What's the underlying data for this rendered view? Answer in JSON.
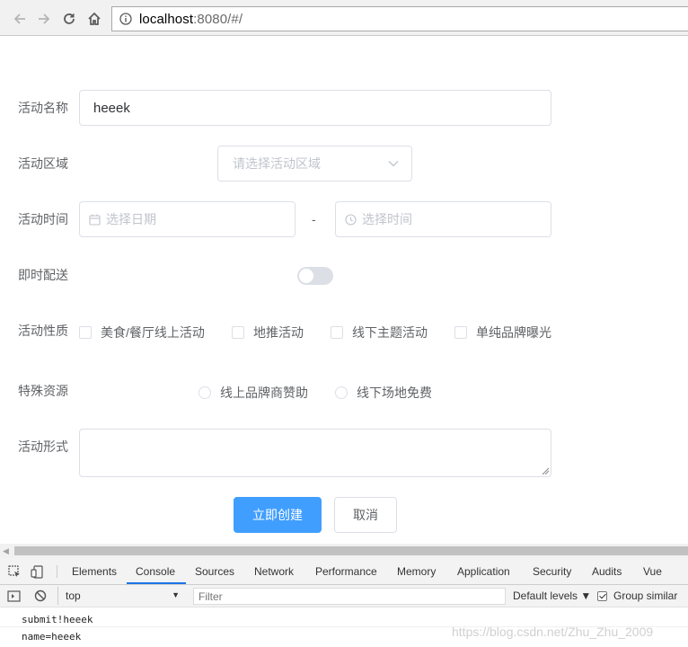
{
  "browser": {
    "url_host": "localhost",
    "url_path": ":8080/#/"
  },
  "form": {
    "name_label": "活动名称",
    "name_value": "heeek",
    "region_label": "活动区域",
    "region_placeholder": "请选择活动区域",
    "time_label": "活动时间",
    "date_placeholder": "选择日期",
    "time_separator": "-",
    "time_placeholder": "选择时间",
    "delivery_label": "即时配送",
    "delivery_on": false,
    "type_label": "活动性质",
    "type_options": [
      "美食/餐厅线上活动",
      "地推活动",
      "线下主题活动",
      "单纯品牌曝光"
    ],
    "resource_label": "特殊资源",
    "resource_options": [
      "线上品牌商赞助",
      "线下场地免费"
    ],
    "form_label": "活动形式",
    "submit_label": "立即创建",
    "cancel_label": "取消"
  },
  "devtools": {
    "tabs": [
      "Elements",
      "Console",
      "Sources",
      "Network",
      "Performance",
      "Memory",
      "Application",
      "Security",
      "Audits",
      "Vue"
    ],
    "active_tab": "Console",
    "context": "top",
    "filter_placeholder": "Filter",
    "levels": "Default levels ▼",
    "group_similar": "Group similar",
    "console_lines": [
      "submit!heeek",
      "name=heeek"
    ]
  },
  "watermark": "https://blog.csdn.net/Zhu_Zhu_2009"
}
